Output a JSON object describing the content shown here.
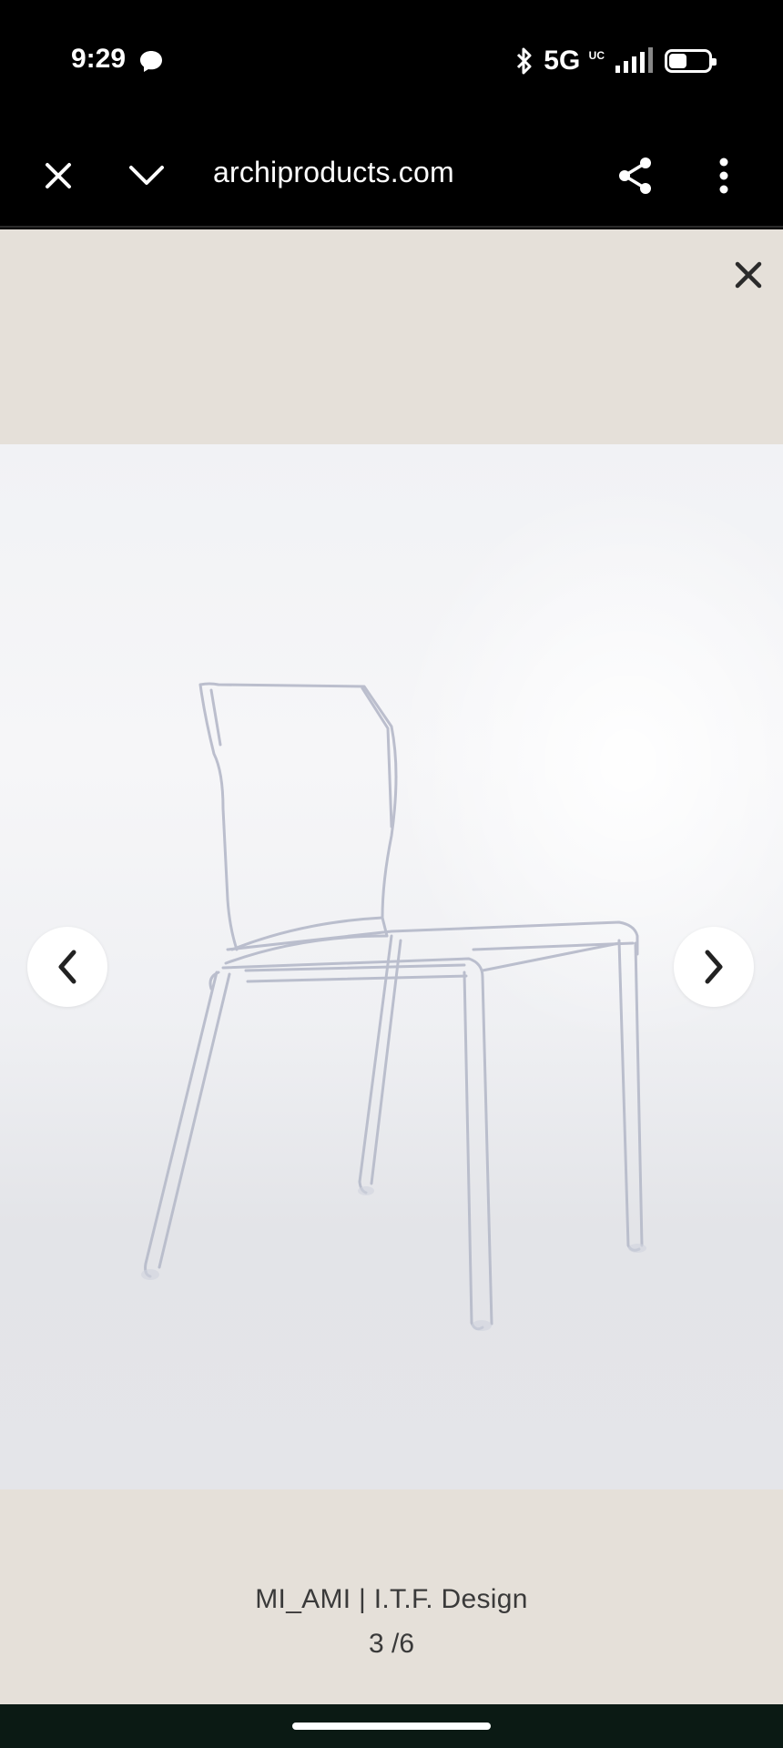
{
  "status_bar": {
    "time": "9:29",
    "network": "5G",
    "network_suffix": "UC",
    "battery_level": 0.5,
    "icons": [
      "messenger-icon",
      "bluetooth-icon",
      "signal-icon",
      "battery-icon"
    ]
  },
  "browser": {
    "url": "archiproducts.com",
    "icons": [
      "close-icon",
      "chevron-down-icon",
      "share-icon",
      "more-vert-icon"
    ]
  },
  "lightbox": {
    "caption": "MI_AMI | I.T.F. Design",
    "counter": "3 /6",
    "icons": [
      "close-icon",
      "chevron-left-icon",
      "chevron-right-icon"
    ]
  },
  "colors": {
    "page_background": "#e5e0d9",
    "browser_bar": "#000000",
    "text": "#3a3a3a"
  }
}
